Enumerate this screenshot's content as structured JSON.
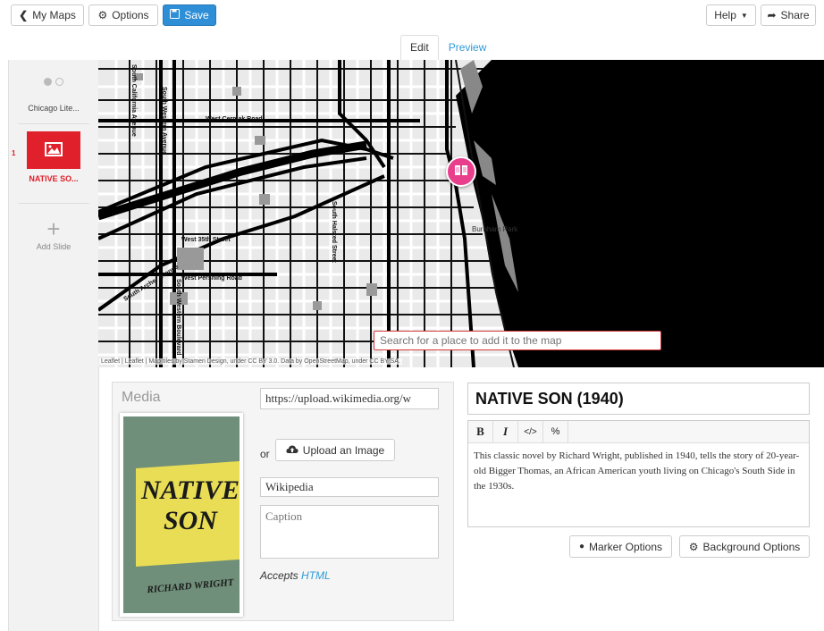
{
  "topbar": {
    "my_maps": "My Maps",
    "options": "Options",
    "save": "Save",
    "help": "Help",
    "share": "Share"
  },
  "tabs": {
    "edit": "Edit",
    "preview": "Preview"
  },
  "sidebar": {
    "slides": [
      {
        "label": "Chicago Lite..."
      },
      {
        "number": "1",
        "label": "NATIVE SO..."
      }
    ],
    "add_slide": "Add Slide"
  },
  "map": {
    "search_placeholder": "Search for a place to add it to the map",
    "attribution": "Leaflet | Leaflet | Map tiles by Stamen Design, under CC BY 3.0. Data by OpenStreetMap, under CC BY SA.",
    "street_labels": [
      "West Cermak Road",
      "South Western Avenue",
      "South California Avenue",
      "West 35th Street",
      "South Archer Avenue",
      "West Pershing Road",
      "South Western Boulevard",
      "South Halsted Street",
      "Burnham Park",
      "South Western Blvd"
    ]
  },
  "media": {
    "title": "Media",
    "url": "https://upload.wikimedia.org/w",
    "or": "or",
    "upload_button": "Upload an Image",
    "credit": "Wikipedia",
    "caption_placeholder": "Caption",
    "accepts": "Accepts",
    "accepts_link": "HTML"
  },
  "book": {
    "title_line1": "NATIVE",
    "title_line2": "SON",
    "author": "RICHARD WRIGHT"
  },
  "slide_editor": {
    "title": "NATIVE SON (1940)",
    "toolbar": {
      "bold": "B",
      "italic": "I",
      "code": "</>",
      "link": "%"
    },
    "body": "This classic novel by Richard Wright, published in 1940, tells the story of 20-year-old Bigger Thomas, an African American youth living on Chicago's South Side in the 1930s.",
    "marker_options": "Marker Options",
    "background_options": "Background Options"
  },
  "colors": {
    "primary": "#2e8fd6",
    "accent_red": "#e0202a",
    "marker_pink": "#e83e8c"
  }
}
